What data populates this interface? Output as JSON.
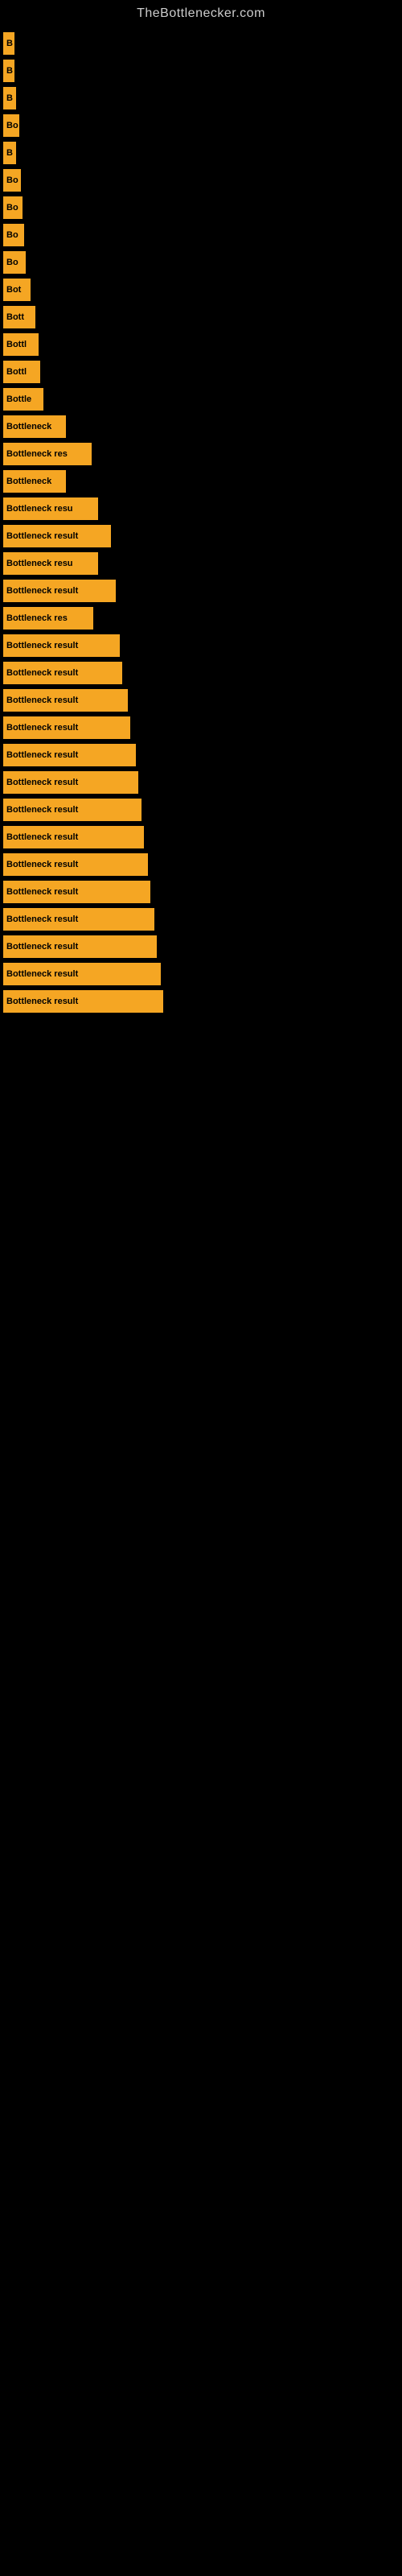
{
  "site": {
    "title": "TheBottlenecker.com"
  },
  "bars": [
    {
      "id": 1,
      "label": "B",
      "width": 14
    },
    {
      "id": 2,
      "label": "B",
      "width": 14
    },
    {
      "id": 3,
      "label": "B",
      "width": 16
    },
    {
      "id": 4,
      "label": "Bo",
      "width": 20
    },
    {
      "id": 5,
      "label": "B",
      "width": 16
    },
    {
      "id": 6,
      "label": "Bo",
      "width": 22
    },
    {
      "id": 7,
      "label": "Bo",
      "width": 24
    },
    {
      "id": 8,
      "label": "Bo",
      "width": 26
    },
    {
      "id": 9,
      "label": "Bo",
      "width": 28
    },
    {
      "id": 10,
      "label": "Bot",
      "width": 34
    },
    {
      "id": 11,
      "label": "Bott",
      "width": 40
    },
    {
      "id": 12,
      "label": "Bottl",
      "width": 44
    },
    {
      "id": 13,
      "label": "Bottl",
      "width": 46
    },
    {
      "id": 14,
      "label": "Bottle",
      "width": 50
    },
    {
      "id": 15,
      "label": "Bottleneck",
      "width": 78
    },
    {
      "id": 16,
      "label": "Bottleneck res",
      "width": 110
    },
    {
      "id": 17,
      "label": "Bottleneck",
      "width": 78
    },
    {
      "id": 18,
      "label": "Bottleneck resu",
      "width": 118
    },
    {
      "id": 19,
      "label": "Bottleneck result",
      "width": 134
    },
    {
      "id": 20,
      "label": "Bottleneck resu",
      "width": 118
    },
    {
      "id": 21,
      "label": "Bottleneck result",
      "width": 140
    },
    {
      "id": 22,
      "label": "Bottleneck res",
      "width": 112
    },
    {
      "id": 23,
      "label": "Bottleneck result",
      "width": 145
    },
    {
      "id": 24,
      "label": "Bottleneck result",
      "width": 148
    },
    {
      "id": 25,
      "label": "Bottleneck result",
      "width": 155
    },
    {
      "id": 26,
      "label": "Bottleneck result",
      "width": 158
    },
    {
      "id": 27,
      "label": "Bottleneck result",
      "width": 165
    },
    {
      "id": 28,
      "label": "Bottleneck result",
      "width": 168
    },
    {
      "id": 29,
      "label": "Bottleneck result",
      "width": 172
    },
    {
      "id": 30,
      "label": "Bottleneck result",
      "width": 175
    },
    {
      "id": 31,
      "label": "Bottleneck result",
      "width": 180
    },
    {
      "id": 32,
      "label": "Bottleneck result",
      "width": 183
    },
    {
      "id": 33,
      "label": "Bottleneck result",
      "width": 188
    },
    {
      "id": 34,
      "label": "Bottleneck result",
      "width": 191
    },
    {
      "id": 35,
      "label": "Bottleneck result",
      "width": 196
    },
    {
      "id": 36,
      "label": "Bottleneck result",
      "width": 199
    }
  ]
}
